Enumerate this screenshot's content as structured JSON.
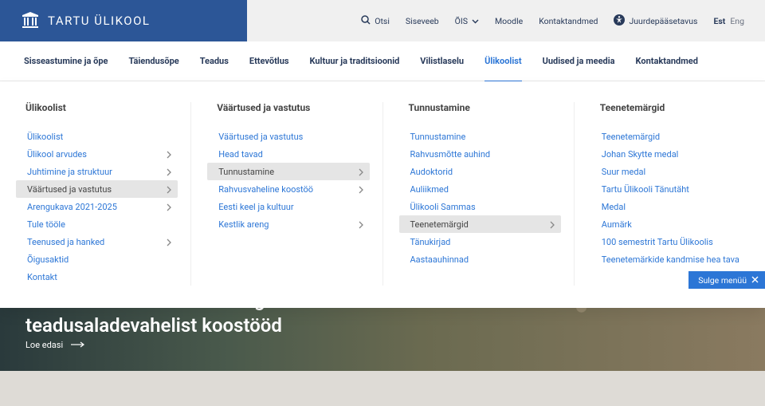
{
  "top": {
    "brand": "TARTU ÜLIKOOL",
    "search": "Otsi",
    "siseveeb": "Siseveeb",
    "ois": "ÕIS",
    "moodle": "Moodle",
    "kontakt": "Kontaktandmed",
    "access": "Juurdepääsetavus",
    "lang_active": "Est",
    "lang_other": "Eng"
  },
  "nav": [
    "Sisseastumine ja õpe",
    "Täiendusõpe",
    "Teadus",
    "Ettevõtlus",
    "Kultuur ja traditsioonid",
    "Vilistlaselu",
    "Ülikoolist",
    "Uudised ja meedia",
    "Kontaktandmed"
  ],
  "nav_active_index": 6,
  "mega": {
    "col1": {
      "title": "Ülikoolist",
      "items": [
        {
          "label": "Ülikoolist",
          "arrow": false
        },
        {
          "label": "Ülikool arvudes",
          "arrow": true
        },
        {
          "label": "Juhtimine ja struktuur",
          "arrow": true
        },
        {
          "label": "Väärtused ja vastutus",
          "arrow": true,
          "selected": true
        },
        {
          "label": "Arengukava 2021-2025",
          "arrow": true
        },
        {
          "label": "Tule tööle",
          "arrow": false
        },
        {
          "label": "Teenused ja hanked",
          "arrow": true
        },
        {
          "label": "Õigusaktid",
          "arrow": false
        },
        {
          "label": "Kontakt",
          "arrow": false
        }
      ]
    },
    "col2": {
      "title": "Väärtused ja vastutus",
      "items": [
        {
          "label": "Väärtused ja vastutus",
          "arrow": false
        },
        {
          "label": "Head tavad",
          "arrow": false
        },
        {
          "label": "Tunnustamine",
          "arrow": true,
          "selected": true
        },
        {
          "label": "Rahvusvaheline koostöö",
          "arrow": true
        },
        {
          "label": "Eesti keel ja kultuur",
          "arrow": false
        },
        {
          "label": "Kestlik areng",
          "arrow": true
        }
      ]
    },
    "col3": {
      "title": "Tunnustamine",
      "items": [
        {
          "label": "Tunnustamine",
          "arrow": false
        },
        {
          "label": "Rahvusmõtte auhind",
          "arrow": false
        },
        {
          "label": "Audoktorid",
          "arrow": false
        },
        {
          "label": "Auliikmed",
          "arrow": false
        },
        {
          "label": "Ülikooli Sammas",
          "arrow": false
        },
        {
          "label": "Teenetemärgid",
          "arrow": true,
          "selected": true
        },
        {
          "label": "Tänukirjad",
          "arrow": false
        },
        {
          "label": "Aastaauhinnad",
          "arrow": false
        }
      ]
    },
    "col4": {
      "title": "Teenetemärgid",
      "items": [
        {
          "label": "Teenetemärgid",
          "arrow": false
        },
        {
          "label": "Johan Skytte medal",
          "arrow": false
        },
        {
          "label": "Suur medal",
          "arrow": false
        },
        {
          "label": "Tartu Ülikooli Tänutäht",
          "arrow": false
        },
        {
          "label": "Medal",
          "arrow": false
        },
        {
          "label": "Aumärk",
          "arrow": false
        },
        {
          "label": "100 semestrit Tartu Ülikoolis",
          "arrow": false
        },
        {
          "label": "Teenetemärkide kandmise hea tava",
          "arrow": false
        }
      ]
    },
    "close": "Sulge menüü"
  },
  "hero": {
    "title": "Tartu Ülikooli kestliku arengu keskus hõlbustab teadusaladevahelist koostööd",
    "cta": "Loe edasi"
  }
}
